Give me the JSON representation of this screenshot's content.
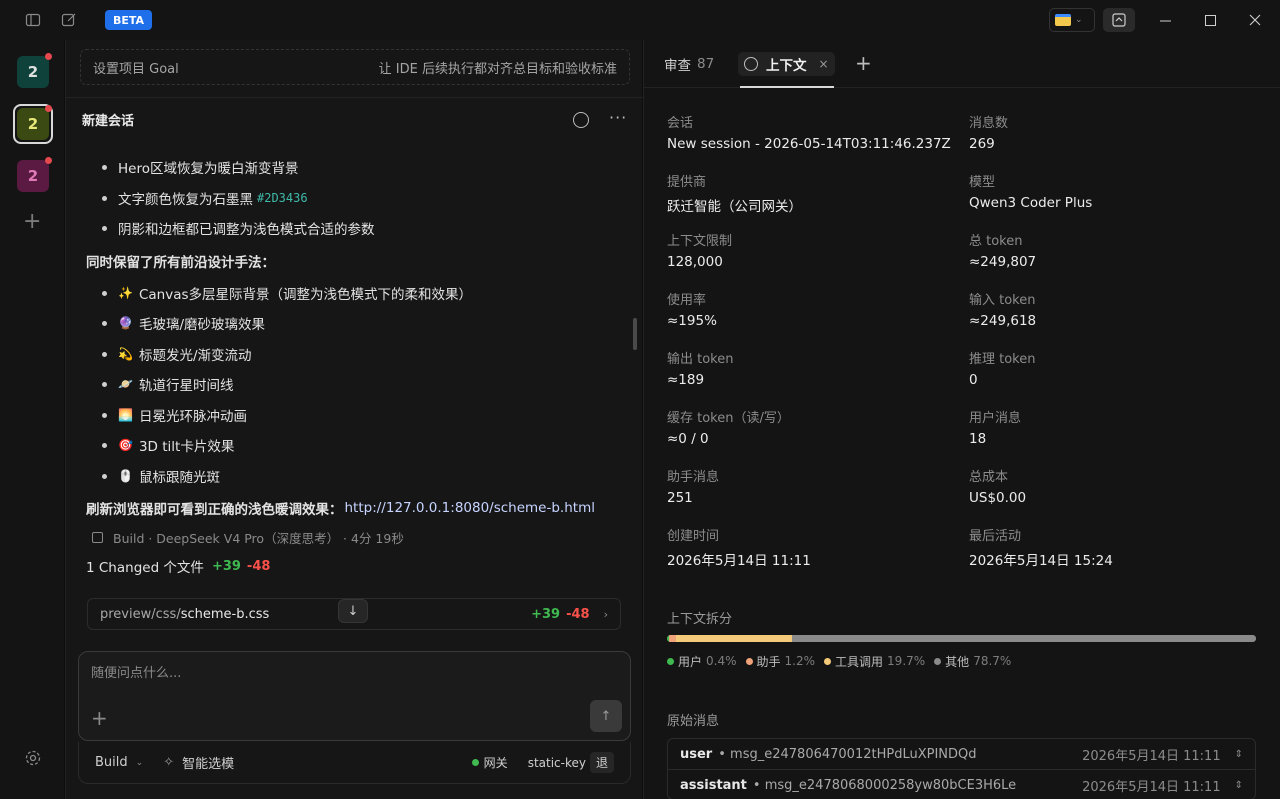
{
  "titlebar": {
    "beta": "BETA"
  },
  "rail": {
    "workspaces": [
      "2",
      "2",
      "2"
    ]
  },
  "chat": {
    "goal_label": "设置项目 Goal",
    "goal_hint": "让 IDE 后续执行都对齐总目标和验收标准",
    "title": "新建会话",
    "bullets_top": [
      "Hero区域恢复为暖白渐变背景",
      "文字颜色恢复为石墨黑",
      "阴影和边框都已调整为浅色模式合适的参数"
    ],
    "color_code": "#2D3436",
    "para1": "同时保留了所有前沿设计手法：",
    "bullets_design": [
      {
        "emoji": "✨",
        "text": "Canvas多层星际背景（调整为浅色模式下的柔和效果）"
      },
      {
        "emoji": "🔮",
        "text": "毛玻璃/磨砂玻璃效果"
      },
      {
        "emoji": "💫",
        "text": "标题发光/渐变流动"
      },
      {
        "emoji": "🪐",
        "text": "轨道行星时间线"
      },
      {
        "emoji": "🌅",
        "text": "日冕光环脉冲动画"
      },
      {
        "emoji": "🎯",
        "text": "3D tilt卡片效果"
      },
      {
        "emoji": "🖱️",
        "text": "鼠标跟随光斑"
      }
    ],
    "refresh_text": "刷新浏览器即可看到正确的浅色暖调效果：",
    "refresh_link": "http://127.0.0.1:8080/scheme-b.html",
    "meta": "Build · DeepSeek V4 Pro（深度思考） · 4分 19秒",
    "changed_label": "1 Changed 个文件",
    "changed_plus": "+39",
    "changed_minus": "-48",
    "file_dir": "preview/css/",
    "file_name": "scheme-b.css",
    "file_plus": "+39",
    "file_minus": "-48",
    "composer_placeholder": "随便问点什么...",
    "mode": "Build",
    "smart_model": "智能选模",
    "gateway": "网关",
    "key": "static-key",
    "back": "退"
  },
  "right": {
    "tab_review": "审查",
    "tab_review_count": "87",
    "tab_context": "上下文",
    "fields": [
      {
        "k": "会话",
        "v": "New session - 2026-05-14T03:11:46.237Z"
      },
      {
        "k": "消息数",
        "v": "269"
      },
      {
        "k": "提供商",
        "v": "跃迁智能（公司网关）"
      },
      {
        "k": "模型",
        "v": "Qwen3 Coder Plus"
      },
      {
        "k": "上下文限制",
        "v": "128,000"
      },
      {
        "k": "总 token",
        "v": "≈249,807"
      },
      {
        "k": "使用率",
        "v": "≈195%"
      },
      {
        "k": "输入 token",
        "v": "≈249,618"
      },
      {
        "k": "输出 token",
        "v": "≈189"
      },
      {
        "k": "推理 token",
        "v": "0"
      },
      {
        "k": "缓存 token（读/写）",
        "v": "≈0 / 0"
      },
      {
        "k": "用户消息",
        "v": "18"
      },
      {
        "k": "助手消息",
        "v": "251"
      },
      {
        "k": "总成本",
        "v": "US$0.00"
      },
      {
        "k": "创建时间",
        "v": "2026年5月14日 11:11"
      },
      {
        "k": "最后活动",
        "v": "2026年5月14日 15:24"
      }
    ],
    "breakdown_label": "上下文拆分",
    "breakdown": [
      {
        "name": "用户",
        "pct": "0.4%",
        "value": 0.4,
        "color": "#3fb950"
      },
      {
        "name": "助手",
        "pct": "1.2%",
        "value": 1.2,
        "color": "#f0a27a"
      },
      {
        "name": "工具调用",
        "pct": "19.7%",
        "value": 19.7,
        "color": "#f5c97a"
      },
      {
        "name": "其他",
        "pct": "78.7%",
        "value": 78.7,
        "color": "#8a8a8a"
      }
    ],
    "raw_label": "原始消息",
    "raw": [
      {
        "role": "user",
        "id": "msg_e247806470012tHPdLuXPINDQd",
        "time": "2026年5月14日 11:11"
      },
      {
        "role": "assistant",
        "id": "msg_e2478068000258yw80bCE3H6Le",
        "time": "2026年5月14日 11:11"
      }
    ]
  }
}
